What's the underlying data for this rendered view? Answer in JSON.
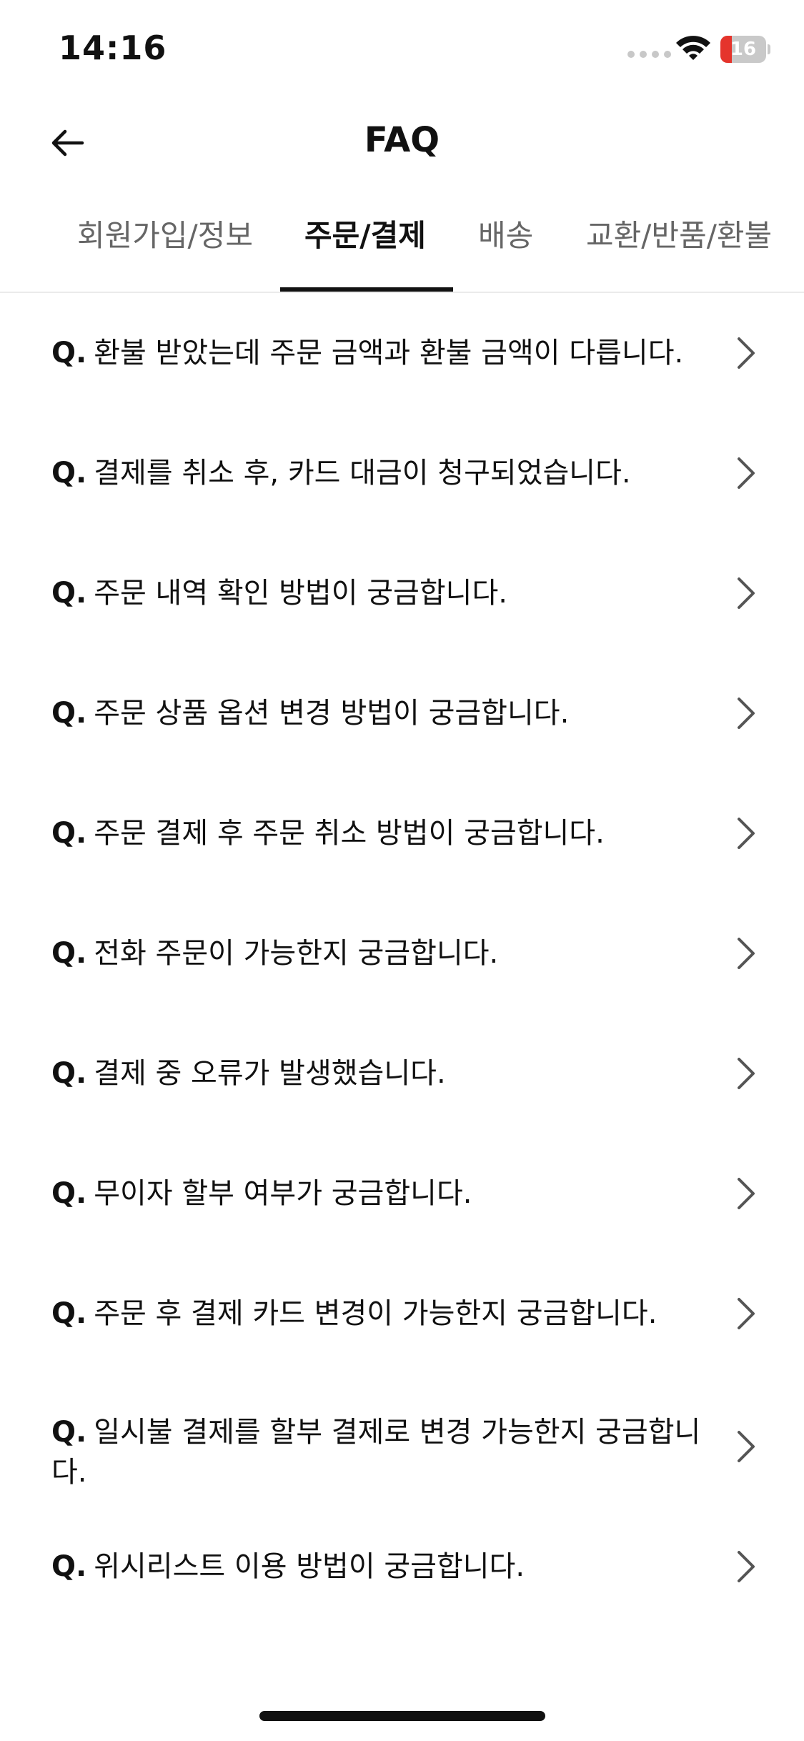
{
  "status_bar": {
    "time": "14:16",
    "battery_level": "16",
    "battery_fraction": 0.16,
    "battery_color": "#e5342c",
    "icons": [
      "signal-dots-icon",
      "wifi-icon",
      "battery-icon"
    ]
  },
  "header": {
    "title": "FAQ",
    "back_icon": "arrow-left-icon"
  },
  "tabs": [
    {
      "label": "회원가입/정보",
      "active": false
    },
    {
      "label": "주문/결제",
      "active": true
    },
    {
      "label": "배송",
      "active": false
    },
    {
      "label": "교환/반품/환불",
      "active": false
    }
  ],
  "faq": {
    "prefix": "Q.",
    "chevron_icon": "chevron-right-icon",
    "items": [
      {
        "question": "환불 받았는데 주문 금액과 환불 금액이 다릅니다."
      },
      {
        "question": "결제를 취소 후, 카드 대금이 청구되었습니다."
      },
      {
        "question": "주문 내역 확인 방법이 궁금합니다."
      },
      {
        "question": "주문 상품 옵션 변경 방법이 궁금합니다."
      },
      {
        "question": "주문 결제 후 주문 취소 방법이 궁금합니다."
      },
      {
        "question": "전화 주문이 가능한지 궁금합니다."
      },
      {
        "question": "결제 중 오류가 발생했습니다."
      },
      {
        "question": "무이자 할부 여부가 궁금합니다."
      },
      {
        "question": "주문 후 결제 카드 변경이 가능한지 궁금합니다."
      },
      {
        "question": "일시불 결제를 할부 결제로 변경 가능한지 궁금합니다."
      },
      {
        "question": "위시리스트 이용 방법이 궁금합니다."
      }
    ]
  }
}
